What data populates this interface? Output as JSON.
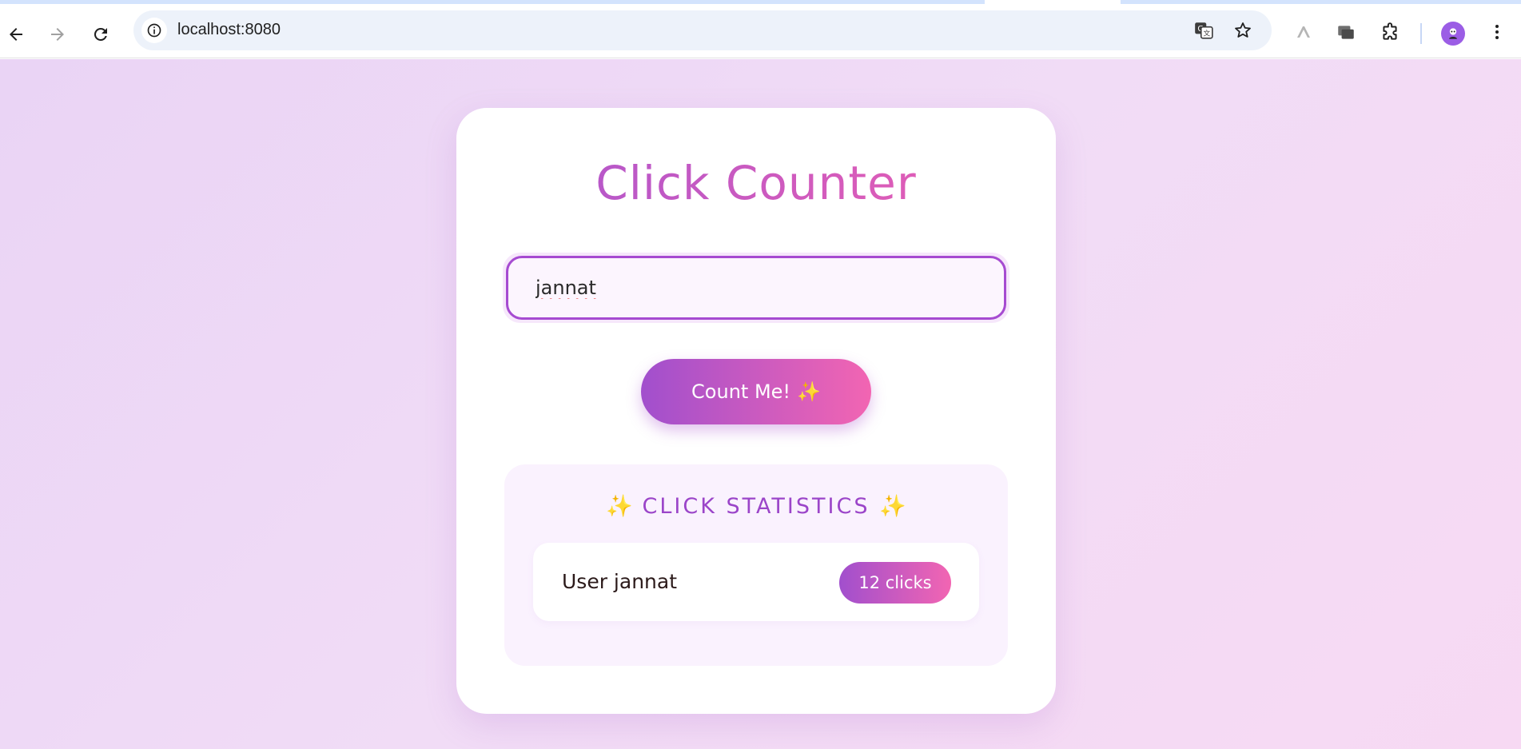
{
  "browser": {
    "url": "localhost:8080"
  },
  "app": {
    "title": "Click Counter",
    "input": {
      "value": "jannat"
    },
    "count_button": {
      "label": "Count Me!",
      "emoji": "✨"
    },
    "stats": {
      "title": "CLICK STATISTICS",
      "sparkle": "✨",
      "rows": [
        {
          "user": "User jannat",
          "clicks": "12 clicks"
        }
      ]
    }
  },
  "colors": {
    "accent_purple": "#a14fcd",
    "accent_pink": "#f265b2",
    "sparkle": "#f5b82e"
  }
}
